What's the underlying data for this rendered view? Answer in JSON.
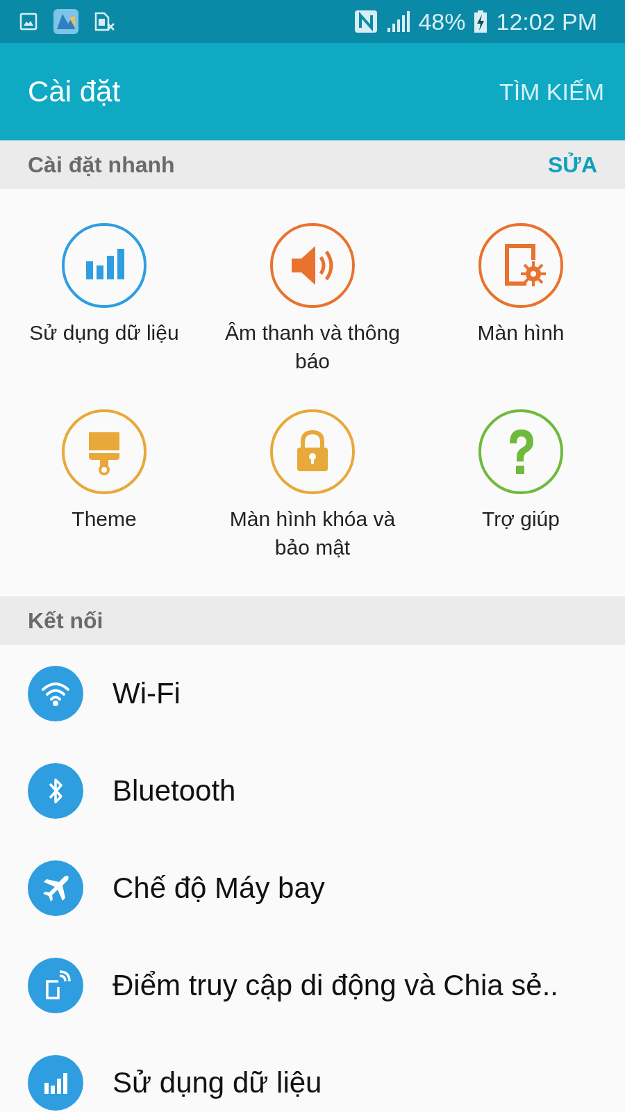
{
  "status_bar": {
    "battery": "48%",
    "time": "12:02 PM"
  },
  "app_bar": {
    "title": "Cài đặt",
    "action": "TÌM KIẾM"
  },
  "quick_settings": {
    "header": "Cài đặt nhanh",
    "action": "SỬA",
    "items": [
      {
        "label": "Sử dụng dữ liệu",
        "kind": "data",
        "color": "#2f9ee0"
      },
      {
        "label": "Âm thanh và thông báo",
        "kind": "sound",
        "color": "#e8732f"
      },
      {
        "label": "Màn hình",
        "kind": "display",
        "color": "#e8732f"
      },
      {
        "label": "Theme",
        "kind": "theme",
        "color": "#e8a83a"
      },
      {
        "label": "Màn hình khóa và bảo mật",
        "kind": "lock",
        "color": "#e8a83a"
      },
      {
        "label": "Trợ giúp",
        "kind": "help",
        "color": "#6fba3c"
      }
    ]
  },
  "connections": {
    "header": "Kết nối",
    "items": [
      {
        "label": "Wi-Fi",
        "kind": "wifi"
      },
      {
        "label": "Bluetooth",
        "kind": "bluetooth"
      },
      {
        "label": "Chế độ Máy bay",
        "kind": "airplane"
      },
      {
        "label": "Điểm truy cập di động và Chia sẻ..",
        "kind": "hotspot"
      },
      {
        "label": "Sử dụng dữ liệu",
        "kind": "data"
      }
    ]
  }
}
